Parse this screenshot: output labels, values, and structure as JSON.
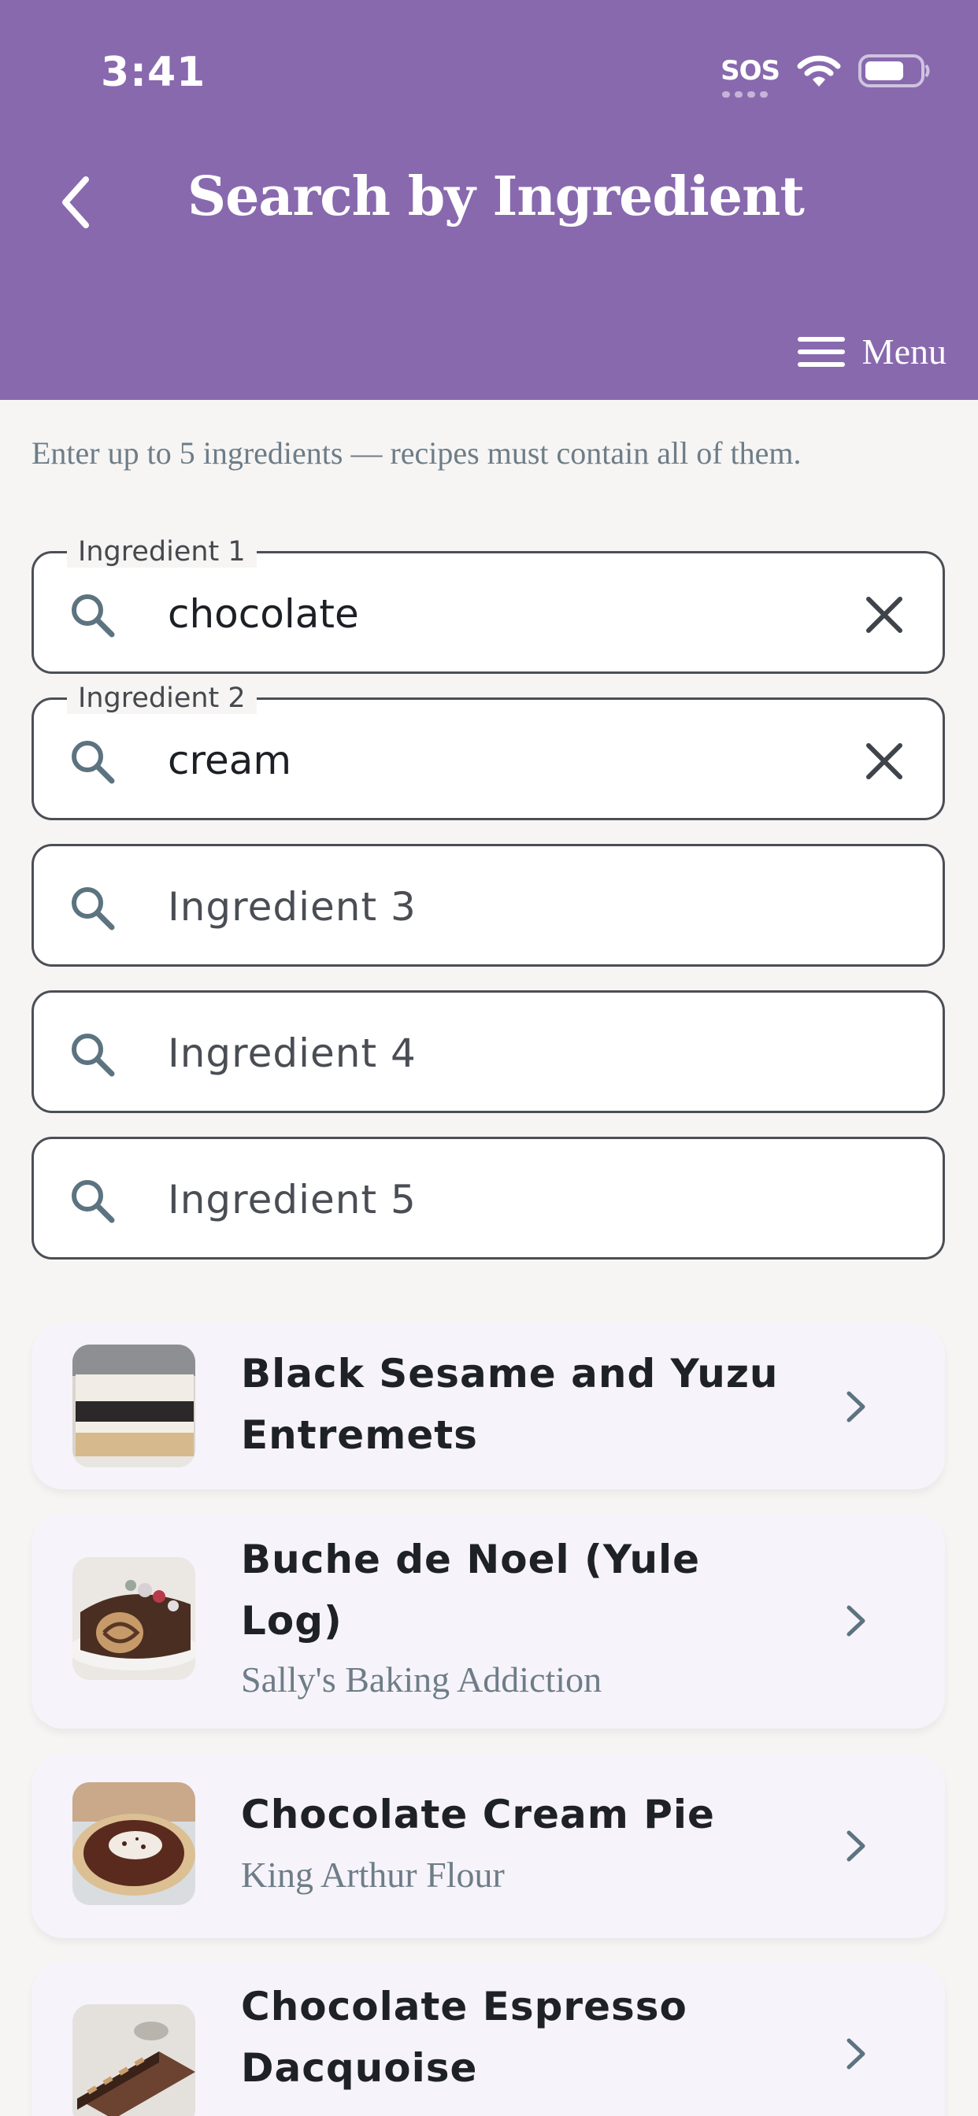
{
  "status_bar": {
    "time": "3:41",
    "sos": "SOS"
  },
  "header": {
    "title": "Search by Ingredient",
    "menu_label": "Menu"
  },
  "instructions": "Enter up to 5 ingredients — recipes must contain all of them.",
  "ingredients": [
    {
      "label": "Ingredient 1",
      "value": "chocolate",
      "placeholder": ""
    },
    {
      "label": "Ingredient 2",
      "value": "cream",
      "placeholder": ""
    },
    {
      "label": "",
      "value": "",
      "placeholder": "Ingredient 3"
    },
    {
      "label": "",
      "value": "",
      "placeholder": "Ingredient 4"
    },
    {
      "label": "",
      "value": "",
      "placeholder": "Ingredient 5"
    }
  ],
  "results": [
    {
      "title_line1": "Black Sesame and Yuzu",
      "title_line2": "Entremets",
      "source": ""
    },
    {
      "title_line1": "Buche de Noel (Yule",
      "title_line2": "Log)",
      "source": "Sally's Baking Addiction"
    },
    {
      "title_line1": "Chocolate Cream Pie",
      "title_line2": "",
      "source": "King Arthur Flour"
    },
    {
      "title_line1": "Chocolate Espresso",
      "title_line2": "Dacquoise",
      "source": ""
    }
  ],
  "colors": {
    "header_bg": "#8869ae",
    "page_bg": "#f6f5f4",
    "card_bg": "#f6f3fa",
    "muted_text": "#6e7d87",
    "icon": "#5c7380"
  }
}
